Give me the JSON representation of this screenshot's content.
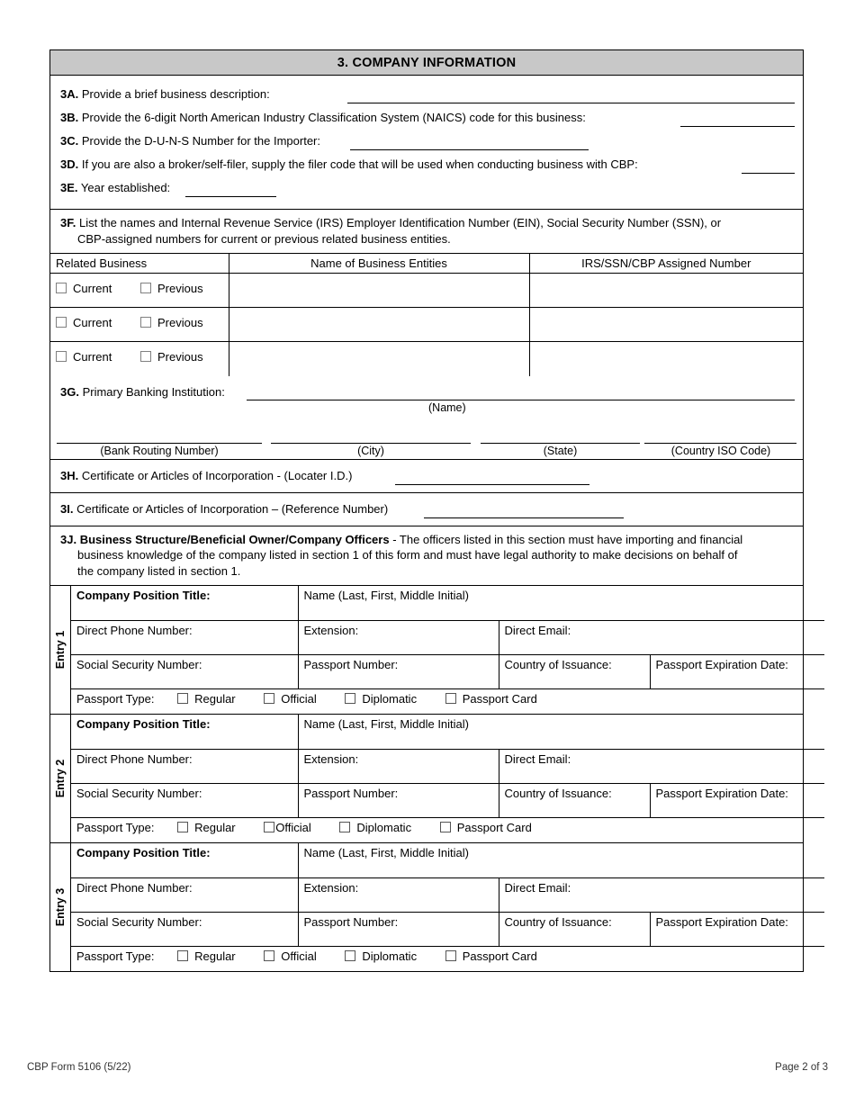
{
  "section": {
    "header": "3. COMPANY INFORMATION"
  },
  "questions": {
    "a": {
      "num": "3A.",
      "text": "Provide a brief business description:"
    },
    "b": {
      "num": "3B.",
      "text": "Provide the 6-digit North American Industry Classification System (NAICS) code for this business:"
    },
    "c": {
      "num": "3C.",
      "text": "Provide the D-U-N-S Number for the Importer:"
    },
    "d": {
      "num": "3D.",
      "text": "If you are also a broker/self-filer, supply the filer code that will be used when conducting business with CBP:"
    },
    "e": {
      "num": "3E.",
      "text": "Year established:"
    }
  },
  "f": {
    "num": "3F.",
    "text_line1": "List the names and Internal Revenue Service (IRS) Employer Identification Number (EIN), Social Security Number (SSN), or",
    "text_line2": "CBP-assigned numbers for current or previous related business entities.",
    "columns": [
      "Related Business",
      "Name of Business Entities",
      "IRS/SSN/CBP Assigned Number"
    ],
    "checkbox_labels": [
      "Current",
      "Previous"
    ],
    "rows": [
      {
        "name_of_entity": "",
        "assigned_number": "",
        "current_checked": false,
        "previous_checked": false
      },
      {
        "name_of_entity": "",
        "assigned_number": "",
        "current_checked": false,
        "previous_checked": false
      },
      {
        "name_of_entity": "",
        "assigned_number": "",
        "current_checked": false,
        "previous_checked": false
      }
    ]
  },
  "g": {
    "num": "3G.",
    "text": "Primary Banking Institution:",
    "name_caption": "(Name)",
    "captions": [
      "(Bank Routing Number)",
      "(City)",
      "(State)",
      "(Country ISO Code)"
    ]
  },
  "h": {
    "num": "3H.",
    "text": "Certificate or Articles of Incorporation - (Locater I.D.)"
  },
  "i": {
    "num": "3I.",
    "text": "Certificate or Articles of Incorporation – (Reference Number)"
  },
  "j": {
    "num": "3J.",
    "title": "Business Structure/Beneficial Owner/Company Officers",
    "text_line1": " - The officers listed in this section must have importing and financial",
    "text_line2": "business knowledge of the company listed in section 1 of this form and must have legal authority to make decisions on behalf of",
    "text_line3": "the company listed in section 1.",
    "field_labels": {
      "position_title": "Company Position Title:",
      "name": "Name (Last, First, Middle Initial)",
      "phone": "Direct Phone Number:",
      "extension": "Extension:",
      "email": "Direct Email:",
      "ssn": "Social Security Number:",
      "passport_number": "Passport Number:",
      "country_of_issuance": "Country of Issuance:",
      "passport_expiration": "Passport Expiration Date:",
      "passport_type": "Passport Type:"
    },
    "passport_types": [
      "Regular",
      "Official",
      "Diplomatic",
      "Passport Card"
    ],
    "entries": [
      {
        "tab": "Entry 1",
        "position_title": "",
        "name": "",
        "phone": "",
        "extension": "",
        "email": "",
        "ssn": "",
        "passport_number": "",
        "country_of_issuance": "",
        "passport_expiration": "",
        "passport_type_checked": [
          false,
          false,
          false,
          false
        ],
        "official_tight": false
      },
      {
        "tab": "Entry 2",
        "position_title": "",
        "name": "",
        "phone": "",
        "extension": "",
        "email": "",
        "ssn": "",
        "passport_number": "",
        "country_of_issuance": "",
        "passport_expiration": "",
        "passport_type_checked": [
          false,
          false,
          false,
          false
        ],
        "official_tight": true
      },
      {
        "tab": "Entry 3",
        "position_title": "",
        "name": "",
        "phone": "",
        "extension": "",
        "email": "",
        "ssn": "",
        "passport_number": "",
        "country_of_issuance": "",
        "passport_expiration": "",
        "passport_type_checked": [
          false,
          false,
          false,
          false
        ],
        "official_tight": false
      }
    ]
  },
  "footer": {
    "form_id": "CBP Form 5106 (5/22)",
    "page": "Page 2 of 3"
  },
  "colors": {
    "header_bar": "#c8c8c8",
    "border": "#000000",
    "checkbox_border": "#808080",
    "footer_text": "#333333"
  }
}
